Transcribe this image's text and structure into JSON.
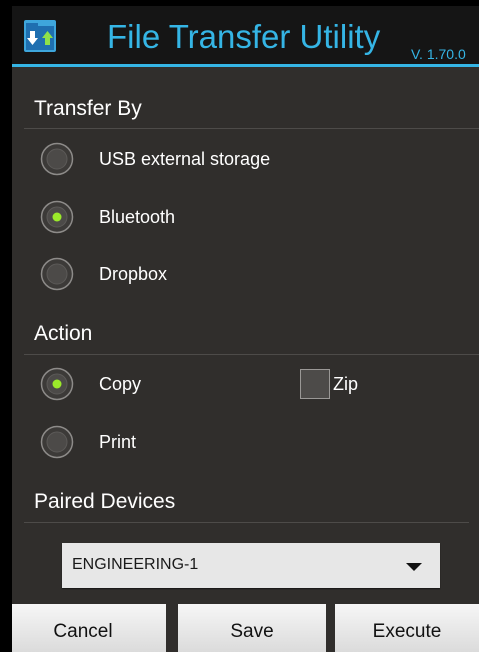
{
  "app": {
    "title": "File Transfer Utility",
    "version": "V. 1.70.0",
    "icon": "file-transfer-icon",
    "accent_color": "#35b5e5"
  },
  "transfer_by": {
    "header": "Transfer By",
    "options": [
      {
        "label": "USB external storage",
        "selected": false
      },
      {
        "label": "Bluetooth",
        "selected": true
      },
      {
        "label": "Dropbox",
        "selected": false
      }
    ]
  },
  "action": {
    "header": "Action",
    "options": [
      {
        "label": "Copy",
        "selected": true
      },
      {
        "label": "Print",
        "selected": false
      }
    ],
    "zip": {
      "label": "Zip",
      "checked": false
    }
  },
  "paired_devices": {
    "header": "Paired Devices",
    "selected": "ENGINEERING-1"
  },
  "buttons": {
    "cancel": "Cancel",
    "save": "Save",
    "execute": "Execute"
  }
}
